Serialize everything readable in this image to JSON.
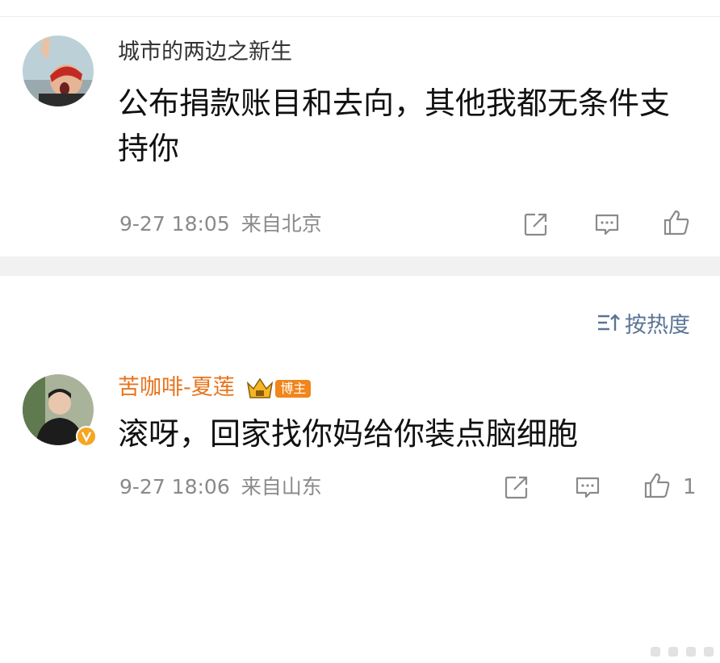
{
  "comments": [
    {
      "username": "城市的两边之新生",
      "username_color": "#333333",
      "content": "公布捐款账目和去向，其他我都无条件支持你",
      "time": "9-27 18:05",
      "location": "来自北京",
      "like_count": "",
      "icons": [
        "share-icon",
        "comment-icon",
        "like-icon"
      ]
    },
    {
      "username": "苦咖啡-夏莲",
      "username_color": "#e8731b",
      "badge_label": "博主",
      "content": "滚呀，回家找你妈给你装点脑细胞",
      "time": "9-27 18:06",
      "location": "来自山东",
      "like_count": "1",
      "icons": [
        "share-icon",
        "comment-icon",
        "like-icon"
      ]
    }
  ],
  "sort": {
    "label": "按热度",
    "icon": "sort-icon"
  },
  "colors": {
    "meta_gray": "#8a8a8a",
    "link_blue": "#5b7494",
    "vip_orange": "#f0861c"
  }
}
